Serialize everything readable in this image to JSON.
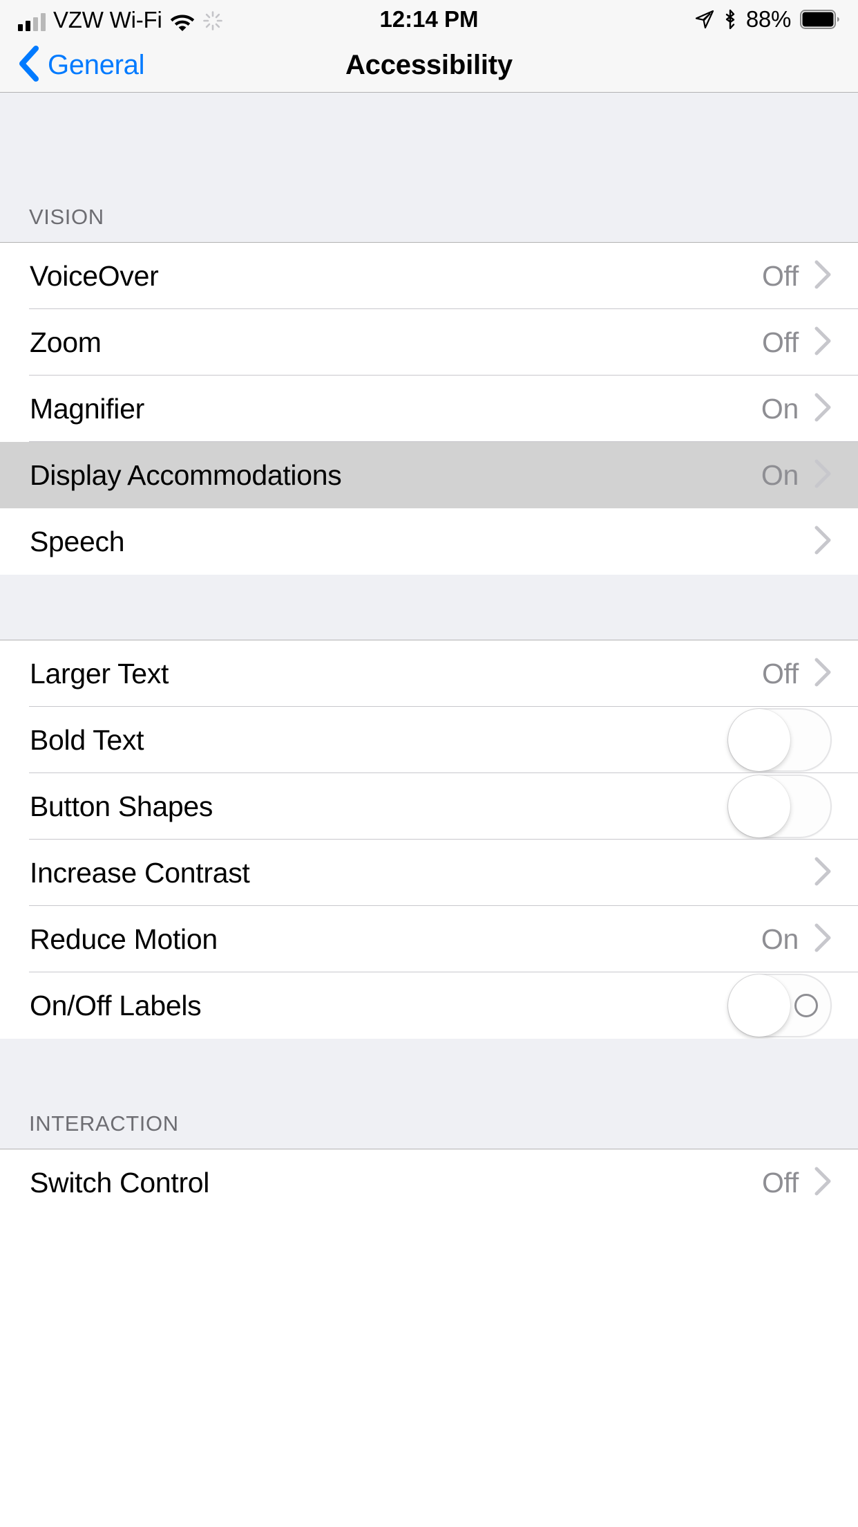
{
  "status_bar": {
    "signal_icon": "signal-bars-icon",
    "carrier": "VZW Wi-Fi",
    "wifi_icon": "wifi-icon",
    "spinner_icon": "activity-spinner-icon",
    "time": "12:14 PM",
    "location_icon": "location-arrow-icon",
    "bluetooth_icon": "bluetooth-icon",
    "battery_percent": "88%",
    "battery_icon": "battery-icon"
  },
  "nav_bar": {
    "back_label": "General",
    "back_icon": "chevron-left-icon",
    "title": "Accessibility"
  },
  "sections": [
    {
      "header": "VISION",
      "rows": [
        {
          "label": "VoiceOver",
          "value": "Off",
          "accessory": "chevron",
          "highlighted": false
        },
        {
          "label": "Zoom",
          "value": "Off",
          "accessory": "chevron",
          "highlighted": false
        },
        {
          "label": "Magnifier",
          "value": "On",
          "accessory": "chevron",
          "highlighted": false
        },
        {
          "label": "Display Accommodations",
          "value": "On",
          "accessory": "chevron",
          "highlighted": true
        },
        {
          "label": "Speech",
          "value": "",
          "accessory": "chevron",
          "highlighted": false
        }
      ]
    },
    {
      "header": "",
      "rows": [
        {
          "label": "Larger Text",
          "value": "Off",
          "accessory": "chevron",
          "highlighted": false
        },
        {
          "label": "Bold Text",
          "value": "",
          "accessory": "toggle",
          "toggle_on": false,
          "toggle_off_mark": false,
          "highlighted": false
        },
        {
          "label": "Button Shapes",
          "value": "",
          "accessory": "toggle",
          "toggle_on": false,
          "toggle_off_mark": false,
          "highlighted": false
        },
        {
          "label": "Increase Contrast",
          "value": "",
          "accessory": "chevron",
          "highlighted": false
        },
        {
          "label": "Reduce Motion",
          "value": "On",
          "accessory": "chevron",
          "highlighted": false
        },
        {
          "label": "On/Off Labels",
          "value": "",
          "accessory": "toggle",
          "toggle_on": false,
          "toggle_off_mark": true,
          "highlighted": false
        }
      ]
    },
    {
      "header": "INTERACTION",
      "rows": [
        {
          "label": "Switch Control",
          "value": "Off",
          "accessory": "chevron",
          "highlighted": false
        }
      ]
    }
  ],
  "colors": {
    "accent_blue": "#007aff",
    "value_gray": "#8e8e93",
    "section_bg": "#eff0f4",
    "highlight_gray": "#d2d2d2",
    "separator": "#c8c7cc"
  }
}
